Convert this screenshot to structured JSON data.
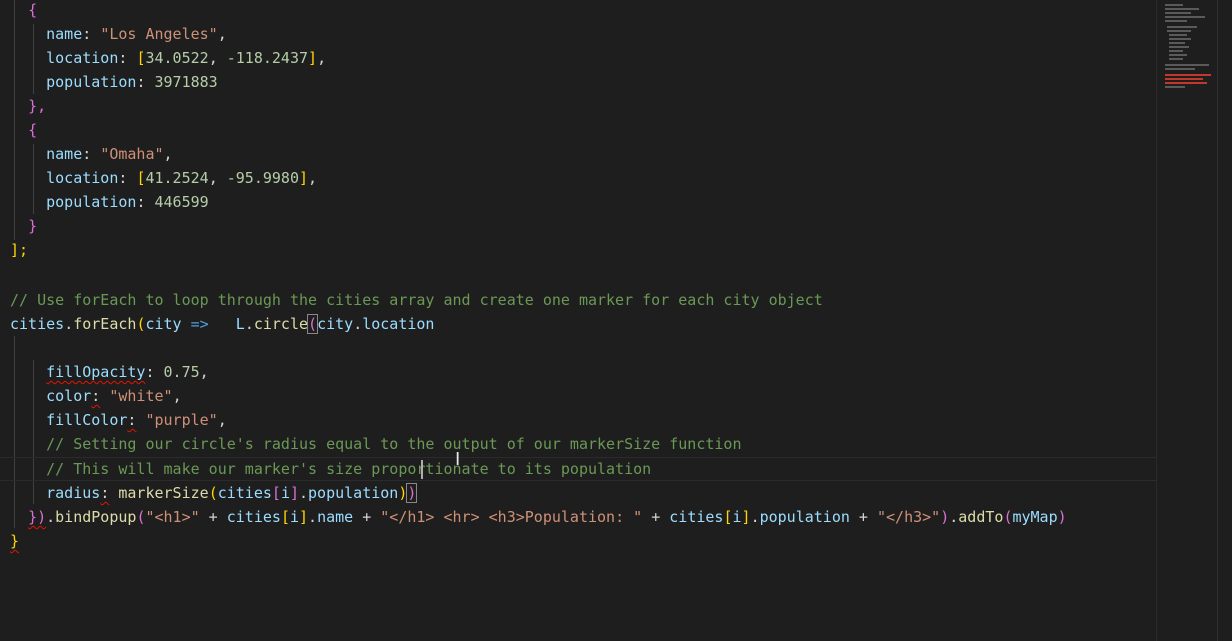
{
  "editor": {
    "language": "javascript",
    "colors": {
      "background": "#1e1e1e",
      "keyword": "#c586c0",
      "string": "#ce9178",
      "number": "#b5cea8",
      "property": "#9cdcfe",
      "function": "#dcdcaa",
      "comment": "#6a9955",
      "error_squiggle": "#e51400"
    }
  },
  "code": {
    "l1_brace": "{",
    "l2_key": "name",
    "l2_val": "\"Los Angeles\"",
    "l3_key": "location",
    "l3_lat": "34.0522",
    "l3_lng": "-118.2437",
    "l4_key": "population",
    "l4_val": "3971883",
    "l5_close": "},",
    "l6_brace": "{",
    "l7_key": "name",
    "l7_val": "\"Omaha\"",
    "l8_key": "location",
    "l8_lat": "41.2524",
    "l8_lng": "-95.9980",
    "l9_key": "population",
    "l9_val": "446599",
    "l10_close": "}",
    "l11_close": "];",
    "comment1": "// Use forEach to loop through the cities array and create one marker for each city object",
    "foreach_obj": "cities",
    "foreach_fn": "forEach",
    "foreach_param": "city",
    "foreach_arrow": "=>",
    "circle_obj": "L",
    "circle_fn": "circle",
    "circle_arg_obj": "city",
    "circle_arg_prop": "location",
    "fillopacity_key": "fillOpacity",
    "fillopacity_val": "0.75",
    "color_key": "color",
    "color_val": "\"white\"",
    "fillcolor_key": "fillColor",
    "fillcolor_val": "\"purple\"",
    "comment2": "// Setting our circle's radius equal to the output of our markerSize function",
    "comment3": "// This will make our marker's size proportionate to its population",
    "radius_key": "radius",
    "radius_fn": "markerSize",
    "radius_arr": "cities",
    "radius_idx": "i",
    "radius_prop": "population",
    "bind_close": "})",
    "bind_fn": "bindPopup",
    "bind_s1": "\"<h1>\"",
    "bind_arr1": "cities",
    "bind_idx1": "i",
    "bind_prop1": "name",
    "bind_s2": "\"</h1> <hr> <h3>Population: \"",
    "bind_arr2": "cities",
    "bind_idx2": "i",
    "bind_prop2": "population",
    "bind_s3": "\"</h3>\"",
    "addto_fn": "addTo",
    "addto_arg": "myMap",
    "last_close": "}"
  }
}
